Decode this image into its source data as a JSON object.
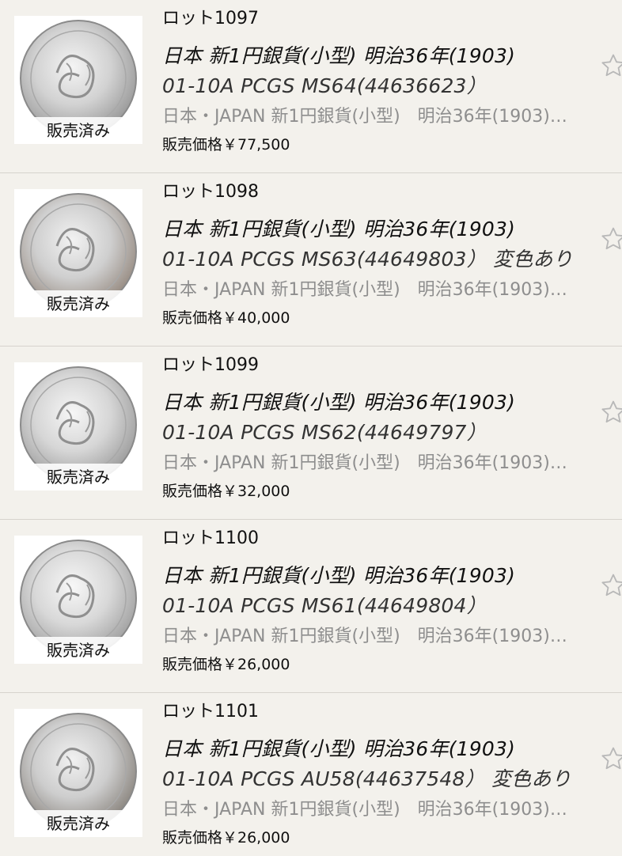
{
  "items": [
    {
      "lot": "ロット1097",
      "title_line1": "日本 新1円銀貨(小型) 明治36年(1903)",
      "title_line2": "01-10A PCGS MS64(44636623）",
      "description": "日本・JAPAN 新1円銀貨(小型)　明治36年(1903)…",
      "price": "販売価格￥77,500",
      "sold_label": "販売済み",
      "star_icon": "star-outline-icon"
    },
    {
      "lot": "ロット1098",
      "title_line1": "日本 新1円銀貨(小型) 明治36年(1903)",
      "title_line2": "01-10A PCGS MS63(44649803）  変色あり",
      "description": "日本・JAPAN 新1円銀貨(小型)　明治36年(1903)…",
      "price": "販売価格￥40,000",
      "sold_label": "販売済み",
      "star_icon": "star-outline-icon"
    },
    {
      "lot": "ロット1099",
      "title_line1": "日本 新1円銀貨(小型) 明治36年(1903)",
      "title_line2": "01-10A PCGS MS62(44649797）",
      "description": "日本・JAPAN 新1円銀貨(小型)　明治36年(1903)…",
      "price": "販売価格￥32,000",
      "sold_label": "販売済み",
      "star_icon": "star-outline-icon"
    },
    {
      "lot": "ロット1100",
      "title_line1": "日本 新1円銀貨(小型) 明治36年(1903)",
      "title_line2": "01-10A PCGS MS61(44649804）",
      "description": "日本・JAPAN 新1円銀貨(小型)　明治36年(1903)…",
      "price": "販売価格￥26,000",
      "sold_label": "販売済み",
      "star_icon": "star-outline-icon"
    },
    {
      "lot": "ロット1101",
      "title_line1": "日本 新1円銀貨(小型) 明治36年(1903)",
      "title_line2": "01-10A PCGS AU58(44637548）  変色あり",
      "description": "日本・JAPAN 新1円銀貨(小型)　明治36年(1903)…",
      "price": "販売価格￥26,000",
      "sold_label": "販売済み",
      "star_icon": "star-outline-icon"
    }
  ],
  "colors": {
    "background": "#f3f1ec",
    "divider": "#d6d3cd",
    "muted_text": "#8e8e8e",
    "star_outline": "#b8b8b8",
    "coin_silver": "#c9c9c9"
  }
}
